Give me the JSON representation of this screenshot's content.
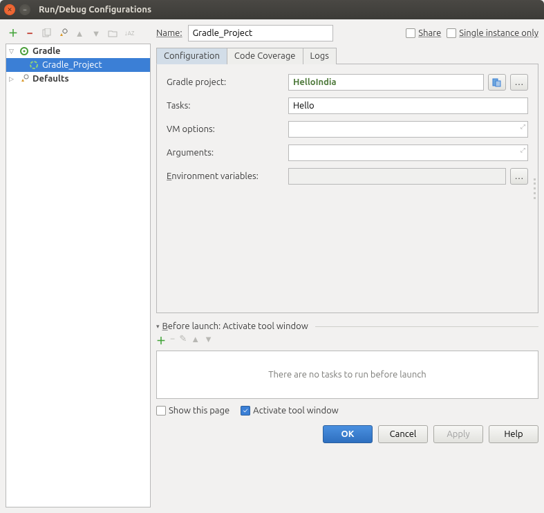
{
  "window": {
    "title": "Run/Debug Configurations"
  },
  "sidebar": {
    "items": [
      {
        "label": "Gradle"
      },
      {
        "label": "Gradle_Project"
      },
      {
        "label": "Defaults"
      }
    ]
  },
  "nameRow": {
    "label": "Name:",
    "value": "Gradle_Project",
    "share": "Share",
    "single": "Single instance only"
  },
  "tabs": {
    "configuration": "Configuration",
    "codeCoverage": "Code Coverage",
    "logs": "Logs"
  },
  "form": {
    "gradleProjectLabel": "Gradle project:",
    "gradleProjectValue": "HelloIndia",
    "tasksLabel": "Tasks:",
    "tasksValue": "Hello",
    "vmLabel": "VM options:",
    "vmValue": "",
    "argsLabel": "Arguments:",
    "argsValue": "",
    "envLabel": "Environment variables:",
    "envValue": ""
  },
  "before": {
    "header": "Before launch: Activate tool window",
    "empty": "There are no tasks to run before launch"
  },
  "bottom": {
    "showThisPage": "Show this page",
    "activateTool": "Activate tool window"
  },
  "buttons": {
    "ok": "OK",
    "cancel": "Cancel",
    "apply": "Apply",
    "help": "Help"
  }
}
